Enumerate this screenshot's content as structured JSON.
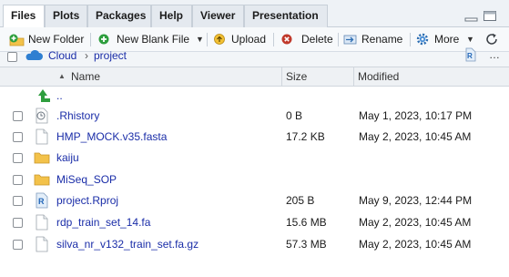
{
  "tabs": [
    {
      "label": "Files",
      "active": true
    },
    {
      "label": "Plots",
      "active": false
    },
    {
      "label": "Packages",
      "active": false
    },
    {
      "label": "Help",
      "active": false
    },
    {
      "label": "Viewer",
      "active": false
    },
    {
      "label": "Presentation",
      "active": false
    }
  ],
  "toolbar": {
    "new_folder": "New Folder",
    "new_blank_file": "New Blank File",
    "upload": "Upload",
    "delete": "Delete",
    "rename": "Rename",
    "more": "More"
  },
  "breadcrumb": {
    "root": "Cloud",
    "separator": "›",
    "current": "project"
  },
  "columns": {
    "name": "Name",
    "sort_indicator": "▲",
    "size": "Size",
    "modified": "Modified"
  },
  "rows": [
    {
      "name": "..",
      "size": "",
      "modified": "",
      "icon": "parent-dir-icon"
    },
    {
      "name": ".Rhistory",
      "size": "0 B",
      "modified": "May 1, 2023, 10:17 PM",
      "icon": "history-file-icon"
    },
    {
      "name": "HMP_MOCK.v35.fasta",
      "size": "17.2 KB",
      "modified": "May 2, 2023, 10:45 AM",
      "icon": "file-icon"
    },
    {
      "name": "kaiju",
      "size": "",
      "modified": "",
      "icon": "folder-icon"
    },
    {
      "name": "MiSeq_SOP",
      "size": "",
      "modified": "",
      "icon": "folder-icon"
    },
    {
      "name": "project.Rproj",
      "size": "205 B",
      "modified": "May 9, 2023, 12:44 PM",
      "icon": "rproj-icon"
    },
    {
      "name": "rdp_train_set_14.fa",
      "size": "15.6 MB",
      "modified": "May 2, 2023, 10:45 AM",
      "icon": "file-icon"
    },
    {
      "name": "silva_nr_v132_train_set.fa.gz",
      "size": "57.3 MB",
      "modified": "May 2, 2023, 10:45 AM",
      "icon": "file-icon"
    }
  ],
  "colors": {
    "link": "#1a2da8",
    "accent_green": "#2e9e3e",
    "folder": "#f3c24a",
    "delete_red": "#c0392b",
    "cloud_blue": "#2f7fd1"
  }
}
